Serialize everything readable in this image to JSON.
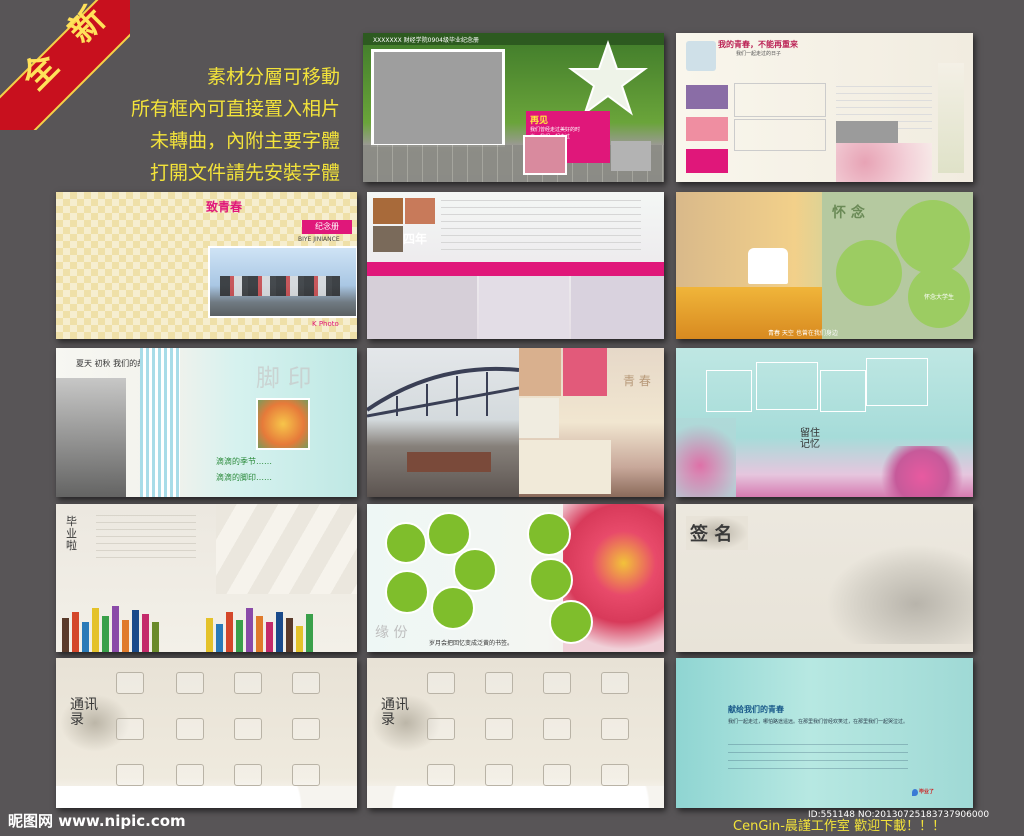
{
  "badge": {
    "label": "全 新"
  },
  "promo_lines": [
    "素材分層可移動",
    "所有框內可直接置入相片",
    "未轉曲，內附主要字體",
    "打開文件請先安裝字體"
  ],
  "pages": {
    "p1_title": "XXXXXXX 财经学院0904级毕业纪念册",
    "p1_pink": "再见",
    "p1_pink_text": "我们曾经走过美好的时光，我们一起走过",
    "p2_title": "我的青春，不能再重来",
    "p2_subtitle": "我们一起走过的日子",
    "p3_title": "致青春",
    "p3_album": "纪念册",
    "p3_pinyin": "BIYE JINIANCE",
    "p3_photo": "K Photo",
    "p4_title": "四年",
    "p5_title": "怀 念",
    "p5_caption": "青春 天空 也曾在我们身边",
    "p5_small": "怀念大学生",
    "p6_heading": "夏天 初秋 我们的故事",
    "p6_footprint": "脚 印",
    "p6_line1": "滴滴的季节……",
    "p6_line2": "滴滴的脚印……",
    "p7_title": "青 春",
    "p8_title": "留住记忆",
    "p9_title": "毕业啦",
    "p10_title": "缘 份",
    "p10_caption": "岁月会把回忆变成泛黄的书签。",
    "p11_title": "签 名",
    "p12_title": "通讯录",
    "p13_title": "通讯录",
    "p14_title": "献给我们的青春",
    "p14_text": "我们一起走过，哪怕路途遥远。在那里我们曾经欢笑过，在那里我们一起哭泣过。"
  },
  "footer": {
    "watermark": "昵图网 www.nipic.com",
    "credit": "CenGin-晨謹工作室  歡迎下載！！！",
    "id_text": "ID:551148 NO:20130725183737906000"
  },
  "colors": {
    "background": "#585557",
    "promo_text": "#f3e33a",
    "badge_red": "#c8101e",
    "green_circle": "#7fbe2c",
    "pink": "#e0177a"
  }
}
